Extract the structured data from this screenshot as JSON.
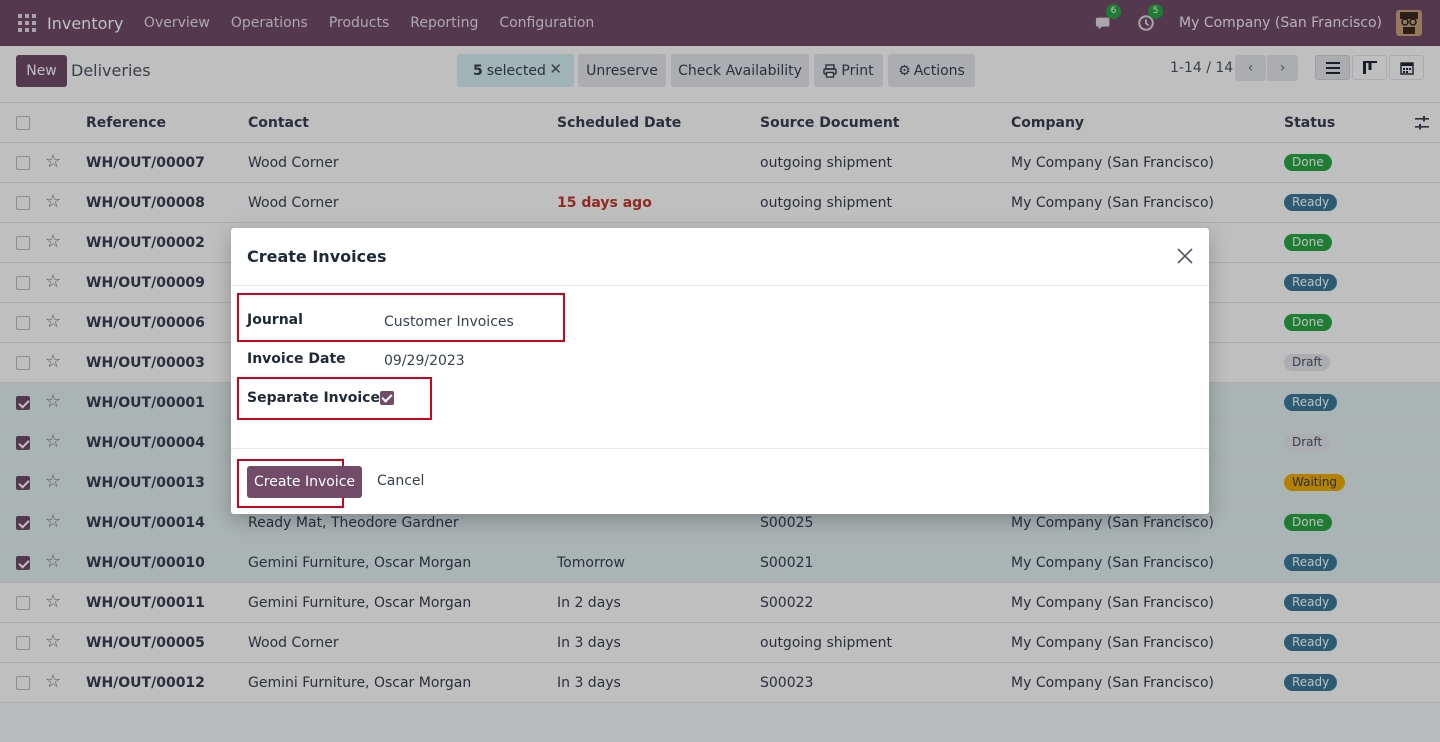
{
  "navbar": {
    "app_name": "Inventory",
    "menu": [
      "Overview",
      "Operations",
      "Products",
      "Reporting",
      "Configuration"
    ],
    "messages_count": "6",
    "activities_count": "5",
    "company": "My Company (San Francisco)"
  },
  "control_panel": {
    "new_label": "New",
    "title": "Deliveries",
    "selected_count": "5",
    "selected_label": "selected",
    "unreserve_label": "Unreserve",
    "check_availability_label": "Check Availability",
    "print_label": "Print",
    "actions_label": "Actions",
    "pager": "1-14 / 14"
  },
  "table": {
    "columns": [
      "Reference",
      "Contact",
      "Scheduled Date",
      "Source Document",
      "Company",
      "Status"
    ],
    "rows": [
      {
        "ref": "WH/OUT/00007",
        "contact": "Wood Corner",
        "date": "",
        "source": "outgoing shipment",
        "company": "My Company (San Francisco)",
        "status": "Done",
        "selected": false
      },
      {
        "ref": "WH/OUT/00008",
        "contact": "Wood Corner",
        "date": "15 days ago",
        "source": "outgoing shipment",
        "company": "My Company (San Francisco)",
        "status": "Ready",
        "selected": false
      },
      {
        "ref": "WH/OUT/00002",
        "contact": "",
        "date": "",
        "source": "",
        "company": "",
        "status": "Done",
        "selected": false
      },
      {
        "ref": "WH/OUT/00009",
        "contact": "",
        "date": "",
        "source": "",
        "company": "",
        "status": "Ready",
        "selected": false
      },
      {
        "ref": "WH/OUT/00006",
        "contact": "",
        "date": "",
        "source": "",
        "company": "",
        "status": "Done",
        "selected": false
      },
      {
        "ref": "WH/OUT/00003",
        "contact": "",
        "date": "",
        "source": "",
        "company": "",
        "status": "Draft",
        "selected": false
      },
      {
        "ref": "WH/OUT/00001",
        "contact": "",
        "date": "",
        "source": "",
        "company": "",
        "status": "Ready",
        "selected": true
      },
      {
        "ref": "WH/OUT/00004",
        "contact": "",
        "date": "",
        "source": "",
        "company": "",
        "status": "Draft",
        "selected": true
      },
      {
        "ref": "WH/OUT/00013",
        "contact": "",
        "date": "",
        "source": "",
        "company": "",
        "status": "Waiting",
        "selected": true
      },
      {
        "ref": "WH/OUT/00014",
        "contact": "Ready Mat, Theodore Gardner",
        "date": "",
        "source": "S00025",
        "company": "My Company (San Francisco)",
        "status": "Done",
        "selected": true
      },
      {
        "ref": "WH/OUT/00010",
        "contact": "Gemini Furniture, Oscar Morgan",
        "date": "Tomorrow",
        "source": "S00021",
        "company": "My Company (San Francisco)",
        "status": "Ready",
        "selected": true
      },
      {
        "ref": "WH/OUT/00011",
        "contact": "Gemini Furniture, Oscar Morgan",
        "date": "In 2 days",
        "source": "S00022",
        "company": "My Company (San Francisco)",
        "status": "Ready",
        "selected": false
      },
      {
        "ref": "WH/OUT/00005",
        "contact": "Wood Corner",
        "date": "In 3 days",
        "source": "outgoing shipment",
        "company": "My Company (San Francisco)",
        "status": "Ready",
        "selected": false
      },
      {
        "ref": "WH/OUT/00012",
        "contact": "Gemini Furniture, Oscar Morgan",
        "date": "In 3 days",
        "source": "S00023",
        "company": "My Company (San Francisco)",
        "status": "Ready",
        "selected": false
      }
    ]
  },
  "dialog": {
    "title": "Create Invoices",
    "journal_label": "Journal",
    "journal_value": "Customer Invoices",
    "invoice_date_label": "Invoice Date",
    "invoice_date_value": "09/29/2023",
    "separate_invoice_label": "Separate Invoice ?",
    "separate_invoice_checked": true,
    "create_button": "Create Invoice",
    "cancel_button": "Cancel"
  },
  "colors": {
    "brand": "#714B67",
    "highlight_box": "#d0021b",
    "selected_row": "#e3f1f2"
  }
}
